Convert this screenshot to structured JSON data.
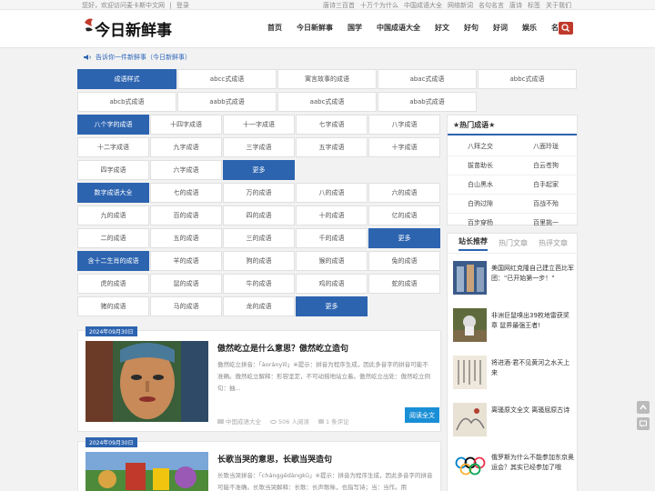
{
  "topbar": {
    "welcome": "您好，欢迎访问麦卡斯中文网",
    "login": "登录",
    "links": [
      "唐诗三百首",
      "十万个为什么",
      "中国成语大全",
      "网络新词",
      "名句名言",
      "唐诗",
      "标签",
      "关于我们"
    ]
  },
  "logo": {
    "text": "今日新鲜事"
  },
  "nav": [
    "首页",
    "今日新鲜事",
    "国学",
    "中国成语大全",
    "好文",
    "好句",
    "好词",
    "娱乐",
    "名字"
  ],
  "notice": {
    "text": "告诉你一件新鲜事（今日新鲜事）"
  },
  "category_rows": [
    [
      "成语样式",
      "abcc式成语",
      "寓言故事的成语",
      "abac式成语",
      "abbc式成语"
    ],
    [
      "abcb式成语",
      "aabb式成语",
      "aabc式成语",
      "abab式成语"
    ]
  ],
  "word_grid": [
    [
      "八个字的成语",
      "十四字成语",
      "十一字成语",
      "七字成语",
      "八字成语"
    ],
    [
      "十二字成语",
      "九字成语",
      "三字成语",
      "五字成语",
      "十字成语"
    ],
    [
      "四字成语",
      "六字成语",
      "更多"
    ],
    [
      "数字成语大全",
      "七的成语",
      "万的成语",
      "八的成语",
      "六的成语"
    ],
    [
      "九的成语",
      "百的成语",
      "四的成语",
      "十的成语",
      "亿的成语"
    ],
    [
      "二的成语",
      "五的成语",
      "三的成语",
      "千的成语",
      "更多"
    ],
    [
      "含十二生肖的成语",
      "羊的成语",
      "狗的成语",
      "猴的成语",
      "兔的成语"
    ],
    [
      "虎的成语",
      "鼠的成语",
      "牛的成语",
      "鸡的成语",
      "蛇的成语"
    ],
    [
      "猪的成语",
      "马的成语",
      "龙的成语",
      "更多"
    ]
  ],
  "hot_idioms": {
    "title": "★热门成语★",
    "items": [
      "八拜之交",
      "八面玲珑",
      "拔苗助长",
      "白云苍狗",
      "白山黑水",
      "白手起家",
      "白驹过隙",
      "百战不殆",
      "百步穿杨",
      "百里挑一"
    ]
  },
  "recommend": {
    "tabs": [
      "站长推荐",
      "热门文章",
      "热评文章"
    ],
    "items": [
      "美国网红克隆自己建立芭比军团：\"已开始第一步！\"",
      "非洲巨鼠嗅出39枚地雷获奖章 鼠界最强王者!",
      "将进酒·君不见黄河之水天上来",
      "离骚原文全文 离骚屈原古诗",
      "俄罗斯为什么不能参加东京奥运会？其实已经参加了哦"
    ]
  },
  "posts": [
    {
      "date": "2024年09月30日",
      "title": "傲然屹立是什么意思？傲然屹立造句",
      "desc": "傲然屹立拼音：「àorányìlì」※提示：拼音为程序生成，因此多音字的拼音可能不准确。傲然屹立解释：形容坚定，不可动摇地站立着。傲然屹立出处：傲然屹立例句：抽...",
      "category": "中国成语大全",
      "views": "506 人阅读",
      "comments": "1 条评论",
      "read_more": "阅读全文"
    },
    {
      "date": "2024年09月30日",
      "title": "长歌当哭的意思，长歌当哭造句",
      "desc": "长歌当哭拼音：「chánggēdàngkū」※提示：拼音为程序生成，因此多音字的拼音可能不准确。长歌当哭解释：长歌：长声歌咏，也指写诗；当：当作。用"
    }
  ],
  "colors": {
    "accent": "#2d64b0",
    "search": "#c0392b",
    "button": "#1a8fd6"
  }
}
